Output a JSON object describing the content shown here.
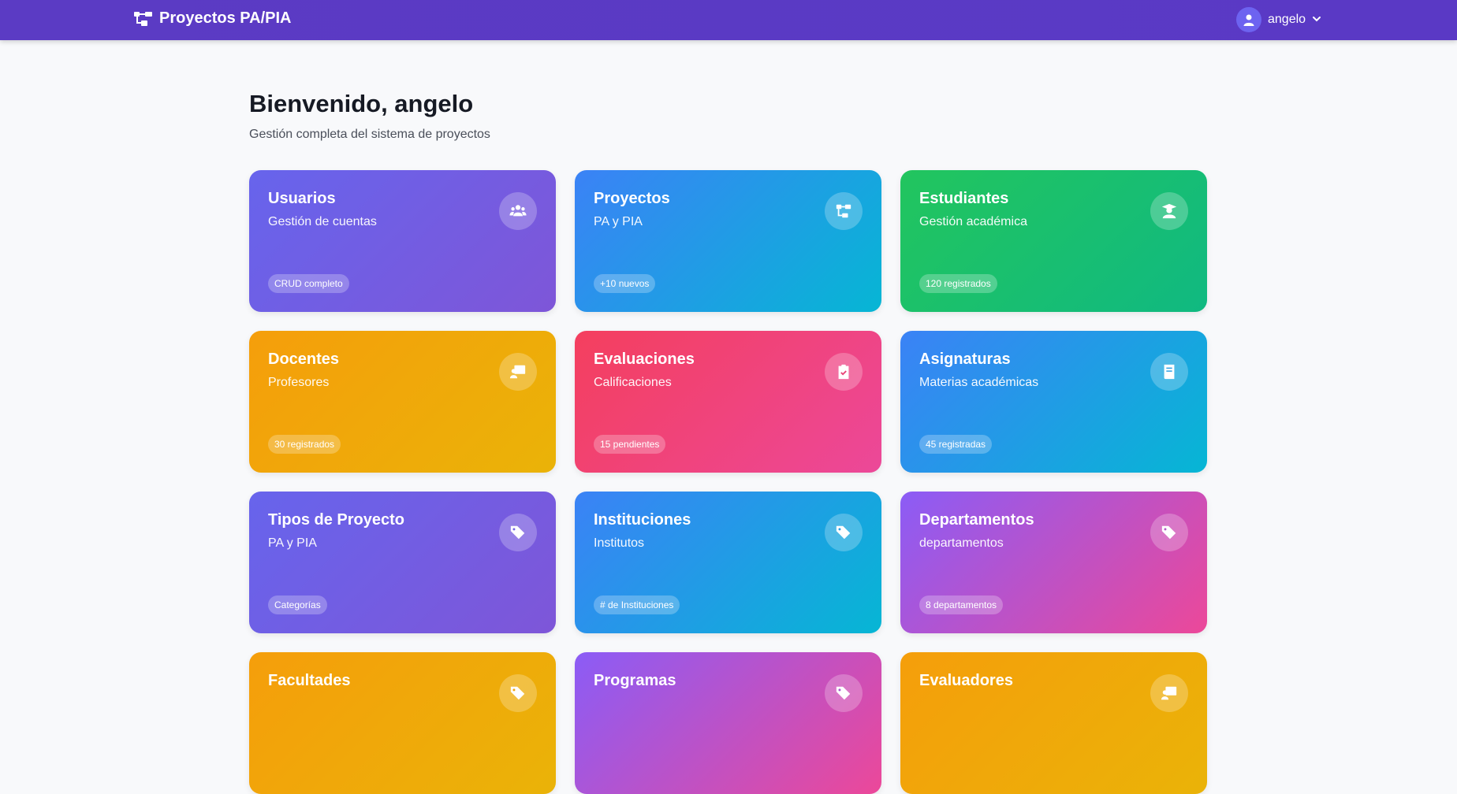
{
  "navbar": {
    "brand": "Proyectos PA/PIA",
    "user": "angelo"
  },
  "header": {
    "title": "Bienvenido, angelo",
    "subtitle": "Gestión completa del sistema de proyectos"
  },
  "cards": [
    {
      "title": "Usuarios",
      "subtitle": "Gestión de cuentas",
      "badge": "CRUD completo",
      "icon": "users-icon"
    },
    {
      "title": "Proyectos",
      "subtitle": "PA y PIA",
      "badge": "+10 nuevos",
      "icon": "sitemap-icon"
    },
    {
      "title": "Estudiantes",
      "subtitle": "Gestión académica",
      "badge": "120 registrados",
      "icon": "graduate-icon"
    },
    {
      "title": "Docentes",
      "subtitle": "Profesores",
      "badge": "30 registrados",
      "icon": "teacher-icon"
    },
    {
      "title": "Evaluaciones",
      "subtitle": "Calificaciones",
      "badge": "15 pendientes",
      "icon": "clipboard-check-icon"
    },
    {
      "title": "Asignaturas",
      "subtitle": "Materias académicas",
      "badge": "45 registradas",
      "icon": "book-icon"
    },
    {
      "title": "Tipos de Proyecto",
      "subtitle": "PA y PIA",
      "badge": "Categorías",
      "icon": "tags-icon"
    },
    {
      "title": "Instituciones",
      "subtitle": "Institutos",
      "badge": "# de Instituciones",
      "icon": "tags-icon"
    },
    {
      "title": "Departamentos",
      "subtitle": "departamentos",
      "badge": "8 departamentos",
      "icon": "tags-icon"
    },
    {
      "title": "Facultades",
      "subtitle": "",
      "badge": "",
      "icon": "tags-icon"
    },
    {
      "title": "Programas",
      "subtitle": "",
      "badge": "",
      "icon": "tags-icon"
    },
    {
      "title": "Evaluadores",
      "subtitle": "",
      "badge": "",
      "icon": "teacher-icon"
    }
  ]
}
